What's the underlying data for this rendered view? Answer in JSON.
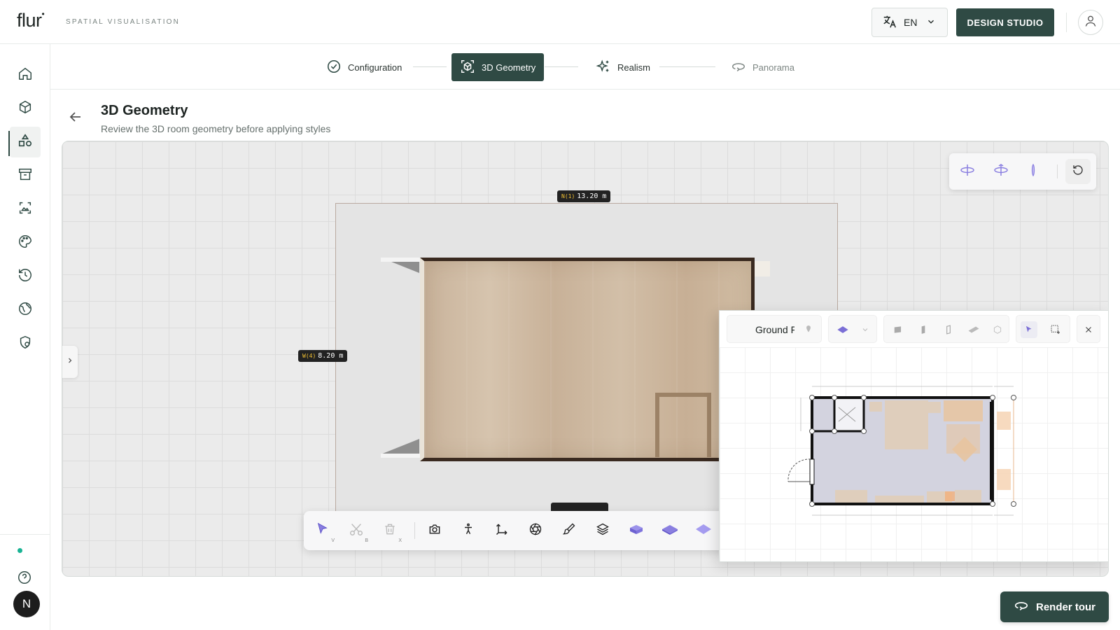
{
  "app": {
    "logo": "flur",
    "logo_mark": "•",
    "tagline": "SPATIAL VISUALISATION"
  },
  "header": {
    "language": "EN",
    "design_studio_label": "DESIGN STUDIO"
  },
  "sidebar": {
    "items": [
      {
        "name": "home",
        "icon": "home-icon"
      },
      {
        "name": "3d-models",
        "icon": "cube-icon"
      },
      {
        "name": "shapes",
        "icon": "shapes-icon",
        "active": true
      },
      {
        "name": "archive",
        "icon": "archive-icon"
      },
      {
        "name": "gallery",
        "icon": "image-icon"
      },
      {
        "name": "palette",
        "icon": "palette-icon"
      },
      {
        "name": "history",
        "icon": "history-icon"
      },
      {
        "name": "globe",
        "icon": "globe-icon"
      },
      {
        "name": "shield",
        "icon": "shield-icon"
      }
    ],
    "user_initial": "N"
  },
  "stepper": {
    "steps": [
      {
        "label": "Configuration",
        "state": "done"
      },
      {
        "label": "3D Geometry",
        "state": "active"
      },
      {
        "label": "Realism",
        "state": "pending"
      },
      {
        "label": "Panorama",
        "state": "pending"
      }
    ]
  },
  "page": {
    "title": "3D Geometry",
    "subtitle": "Review the 3D room geometry before applying styles"
  },
  "viewport": {
    "dimensions": [
      {
        "tag": "N(1)",
        "value": "13.20 m"
      },
      {
        "tag": "W(4)",
        "value": "8.20 m"
      }
    ]
  },
  "toolbar": {
    "tools": [
      {
        "name": "select",
        "key": "V"
      },
      {
        "name": "cut",
        "key": "B"
      },
      {
        "name": "delete",
        "key": "X"
      },
      {
        "name": "camera",
        "key": ""
      },
      {
        "name": "walk",
        "key": ""
      },
      {
        "name": "axes",
        "key": ""
      },
      {
        "name": "aperture",
        "key": ""
      },
      {
        "name": "paint",
        "key": ""
      },
      {
        "name": "layers",
        "key": ""
      },
      {
        "name": "view-box",
        "key": ""
      },
      {
        "name": "view-iso",
        "key": ""
      },
      {
        "name": "view-plan",
        "key": ""
      }
    ]
  },
  "floorplan": {
    "level_label": "Ground Floor"
  },
  "actions": {
    "render_tour_label": "Render tour"
  },
  "colors": {
    "accent": "#2f4a44",
    "tool_purple": "#7b6fd6",
    "status_green": "#19b394"
  }
}
